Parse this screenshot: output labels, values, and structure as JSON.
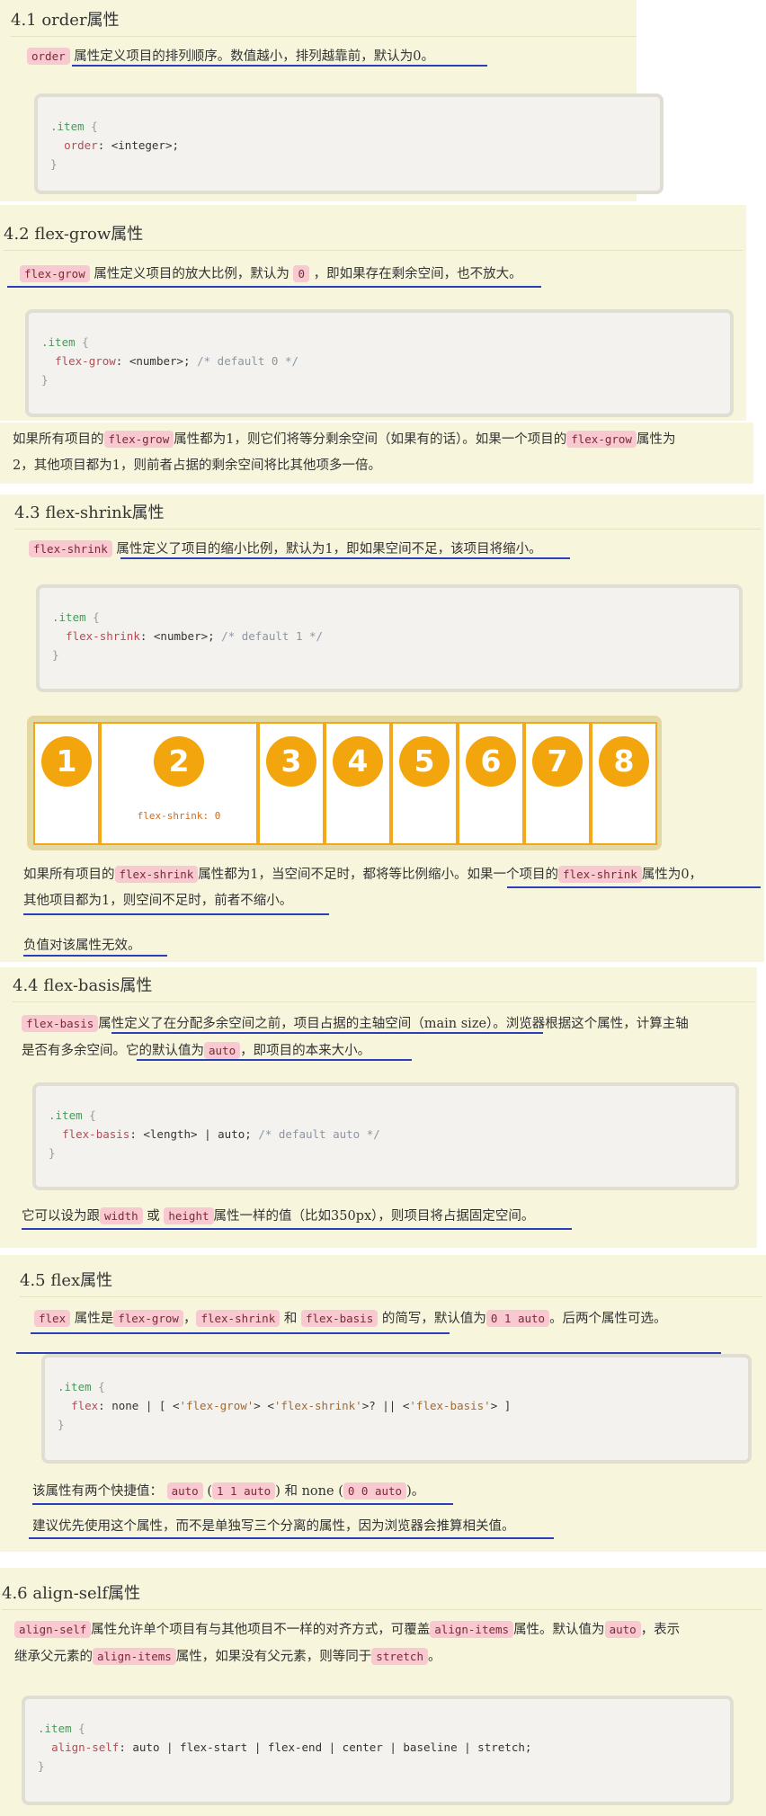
{
  "s41": {
    "heading": "4.1 order属性",
    "c_order": "order",
    "desc": "属性定义项目的排列顺序。数值越小，排列越靠前，默认为0。",
    "code": {
      "sel": ".item",
      "ob": "{",
      "prop": "order",
      "val": ": <integer>;",
      "cb": "}"
    }
  },
  "s42": {
    "heading": "4.2 flex-grow属性",
    "c_grow": "flex-grow",
    "desc_a": "属性定义项目的放大比例，默认为",
    "c_zero": "0",
    "desc_b": "，即如果存在剩余空间，也不放大。",
    "code": {
      "sel": ".item",
      "ob": "{",
      "prop": "flex-grow",
      "val": ": <number>; ",
      "com": "/* default 0 */",
      "cb": "}"
    },
    "note_a": "如果所有项目的",
    "c_g1": "flex-grow",
    "note_b": "属性都为1，则它们将等分剩余空间（如果有的话）。如果一个项目的",
    "c_g2": "flex-grow",
    "note_c": "属性为",
    "note_d": "2，其他项目都为1，则前者占据的剩余空间将比其他项多一倍。"
  },
  "s43": {
    "heading": "4.3 flex-shrink属性",
    "c_shrink": "flex-shrink",
    "desc": "属性定义了项目的缩小比例，默认为1，即如果空间不足，该项目将缩小。",
    "code": {
      "sel": ".item",
      "ob": "{",
      "prop": "flex-shrink",
      "val": ": <number>; ",
      "com": "/* default 1 */",
      "cb": "}"
    },
    "demo": {
      "items": [
        "1",
        "2",
        "3",
        "4",
        "5",
        "6",
        "7",
        "8"
      ],
      "item2_label": "flex-shrink: 0"
    },
    "note_a": "如果所有项目的",
    "c_s1": "flex-shrink",
    "note_b": "属性都为1，当空间不足时，都将等比例缩小。如果一个项目的",
    "c_s2": "flex-shrink",
    "note_c": "属性为0，",
    "note_d": "其他项目都为1，则空间不足时，前者不缩小。",
    "neg": "负值对该属性无效。"
  },
  "s44": {
    "heading": "4.4 flex-basis属性",
    "c_basis": "flex-basis",
    "desc_a": "属性定义了在分配多余空间之前，项目占据的主轴空间（main size）。浏览器根据这个属性，计算主轴",
    "desc_b": "是否有多余空间。它的默认值为",
    "c_auto": "auto",
    "desc_c": "，即项目的本来大小。",
    "code": {
      "sel": ".item",
      "ob": "{",
      "prop": "flex-basis",
      "val": ": <length> | auto; ",
      "com": "/* default auto */",
      "cb": "}"
    },
    "note_a": "它可以设为跟",
    "c_width": "width",
    "note_or": "或",
    "c_height": "height",
    "note_b": "属性一样的值（比如350px），则项目将占据固定空间。"
  },
  "s45": {
    "heading": "4.5 flex属性",
    "c_flex": "flex",
    "d1": "属性是",
    "c_fg": "flex-grow",
    "comma": "，",
    "c_fs": "flex-shrink",
    "and": "和",
    "c_fb": "flex-basis",
    "d2": "的简写，默认值为",
    "c_def": "0 1 auto",
    "d3": "。后两个属性可选。",
    "code": {
      "sel": ".item",
      "ob": "{",
      "prop": "flex",
      "v1": ": none | [ <",
      "s1": "'flex-grow'",
      "v2": "> <",
      "s2": "'flex-shrink'",
      "v3": ">? || <",
      "s3": "'flex-basis'",
      "v4": "> ]",
      "cb": "}"
    },
    "sc_a": "该属性有两个快捷值：",
    "c_sa": "auto",
    "sc_b": "(",
    "c_sb": "1 1 auto",
    "sc_c": ") 和 none (",
    "c_sc": "0 0 auto",
    "sc_d": ")。",
    "advice": "建议优先使用这个属性，而不是单独写三个分离的属性，因为浏览器会推算相关值。"
  },
  "s46": {
    "heading": "4.6 align-self属性",
    "c_as": "align-self",
    "d1": "属性允许单个项目有与其他项目不一样的对齐方式，可覆盖",
    "c_ai": "align-items",
    "d2": "属性。默认值为",
    "c_auto": "auto",
    "d3": "，表示",
    "d4": "继承父元素的",
    "c_ai2": "align-items",
    "d5": "属性，如果没有父元素，则等同于",
    "c_st": "stretch",
    "d6": "。",
    "code": {
      "sel": ".item",
      "ob": "{",
      "prop": "align-self",
      "val": ": auto | flex-start | flex-end | center | baseline | stretch;",
      "cb": "}"
    }
  }
}
